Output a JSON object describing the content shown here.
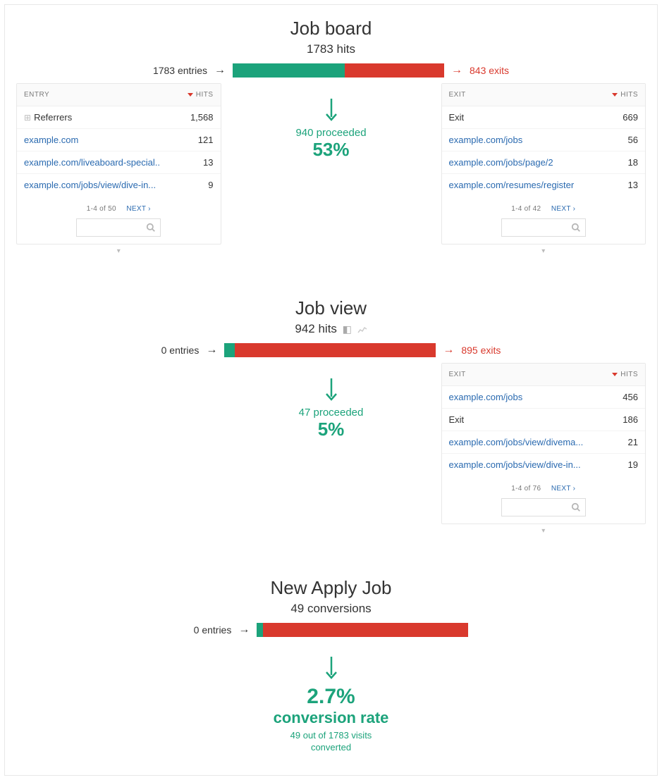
{
  "chart_data": {
    "type": "bar",
    "funnel_steps": [
      {
        "name": "Job board",
        "hits": 1783,
        "entries": 1783,
        "proceeded": 940,
        "proceed_pct": 53,
        "exits": 843
      },
      {
        "name": "Job view",
        "hits": 942,
        "entries": 0,
        "proceeded": 47,
        "proceed_pct": 5,
        "exits": 895
      },
      {
        "name": "New Apply Job",
        "hits": 49,
        "entries": 0
      }
    ],
    "conversion_rate_pct": 2.7,
    "conversions": 49,
    "total_visits": 1783,
    "colors": {
      "proceed": "#1ca37b",
      "exit": "#d9392d"
    }
  },
  "steps": [
    {
      "title": "Job board",
      "subtitle": "1783 hits",
      "entries_label": "1783 entries",
      "exits_label": "843 exits",
      "proceed_label": "940 proceeded",
      "proceed_pct": "53%",
      "bar_green_pct": 53,
      "bar_red_pct": 47,
      "entry_panel": {
        "header_left": "ENTRY",
        "header_right": "HITS",
        "rows": [
          {
            "label": "Referrers",
            "hits": "1,568",
            "dark": true,
            "expand": true
          },
          {
            "label": "example.com",
            "hits": "121"
          },
          {
            "label": "example.com/liveaboard-special..",
            "hits": "13"
          },
          {
            "label": "example.com/jobs/view/dive-in...",
            "hits": "9"
          }
        ],
        "page_info": "1-4 of 50",
        "next": "NEXT ›"
      },
      "exit_panel": {
        "header_left": "EXIT",
        "header_right": "HITS",
        "rows": [
          {
            "label": "Exit",
            "hits": "669",
            "dark": true
          },
          {
            "label": "example.com/jobs",
            "hits": "56"
          },
          {
            "label": "example.com/jobs/page/2",
            "hits": "18"
          },
          {
            "label": "example.com/resumes/register",
            "hits": "13"
          }
        ],
        "page_info": "1-4 of 42",
        "next": "NEXT ›"
      }
    },
    {
      "title": "Job view",
      "subtitle": "942 hits",
      "show_icons": true,
      "entries_label": "0 entries",
      "exits_label": "895 exits",
      "proceed_label": "47 proceeded",
      "proceed_pct": "5%",
      "bar_green_pct": 5,
      "bar_red_pct": 95,
      "exit_panel": {
        "header_left": "EXIT",
        "header_right": "HITS",
        "rows": [
          {
            "label": "example.com/jobs",
            "hits": "456"
          },
          {
            "label": "Exit",
            "hits": "186",
            "dark": true
          },
          {
            "label": "example.com/jobs/view/divema...",
            "hits": "21"
          },
          {
            "label": "example.com/jobs/view/dive-in...",
            "hits": "19"
          }
        ],
        "page_info": "1-4 of 76",
        "next": "NEXT ›"
      }
    },
    {
      "title": "New Apply Job",
      "subtitle": "49 conversions",
      "entries_label": "0 entries",
      "bar_green_pct": 3,
      "bar_red_pct": 97,
      "final": true,
      "final_rate": "2.7%",
      "final_rate_label": "conversion rate",
      "final_sub1": "49 out of 1783 visits",
      "final_sub2": "converted"
    }
  ]
}
